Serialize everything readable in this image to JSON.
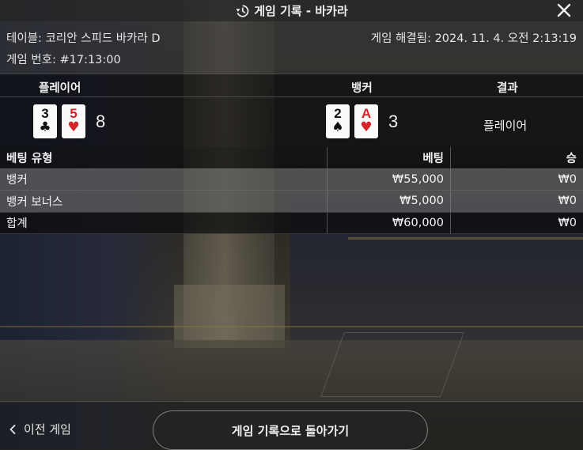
{
  "header": {
    "title": "게임 기록 - 바카라",
    "history_icon": "history-icon",
    "close_icon": "close-icon"
  },
  "info": {
    "table_label": "테이블: 코리안 스피드 바카라 D",
    "resolved_label": "게임 해결됨: 2024. 11. 4. 오전 2:13:19",
    "game_number_label": "게임 번호: #17:13:00"
  },
  "results": {
    "player_header": "플레이어",
    "banker_header": "뱅커",
    "result_header": "결과",
    "player_cards": [
      {
        "rank": "3",
        "suit": "♣",
        "color": "#111111"
      },
      {
        "rank": "5",
        "suit": "♥",
        "color": "#d8222a"
      }
    ],
    "player_score": "8",
    "banker_cards": [
      {
        "rank": "2",
        "suit": "♠",
        "color": "#111111"
      },
      {
        "rank": "A",
        "suit": "♥",
        "color": "#d8222a"
      }
    ],
    "banker_score": "3",
    "winner": "플레이어"
  },
  "bets": {
    "headers": {
      "type": "베팅 유형",
      "bet": "베팅",
      "win": "승"
    },
    "rows": [
      {
        "type": "뱅커",
        "bet": "₩55,000",
        "win": "₩0"
      },
      {
        "type": "뱅커 보너스",
        "bet": "₩5,000",
        "win": "₩0"
      },
      {
        "type": "합계",
        "bet": "₩60,000",
        "win": "₩0"
      }
    ]
  },
  "footer": {
    "prev_label": "이전 게임",
    "back_label": "게임 기록으로 돌아가기"
  }
}
